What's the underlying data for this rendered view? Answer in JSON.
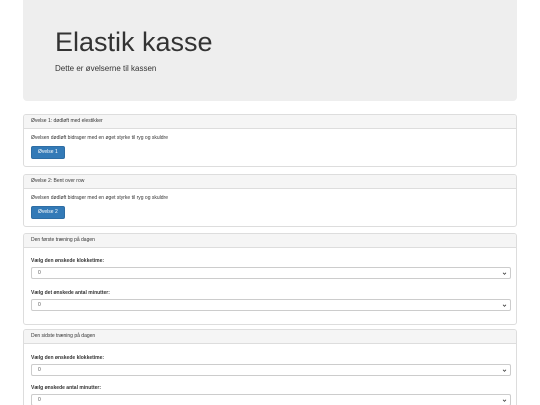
{
  "header": {
    "title": "Elastik kasse",
    "subtitle": "Dette er øvelserne til kassen"
  },
  "exercises": [
    {
      "heading": "Øvelse 1: dødløft med elestikker",
      "description": "Øvelsen dødløft bidrager med en øget styrke til ryg og skuldre",
      "button_label": "Øvelse 1"
    },
    {
      "heading": "Øvelse 2: Bent over row",
      "description": "Øvelsen dødløft bidrager med en øget styrke til ryg og skuldre",
      "button_label": "Øvelse 2"
    }
  ],
  "first_training": {
    "heading": "Den første træning på dagen",
    "hour_label": "Vælg den ønskede klokketime:",
    "hour_value": "0",
    "minutes_label": "Vælg det ønskede antal minutter:",
    "minutes_value": "0"
  },
  "last_training": {
    "heading": "Den sidste træning på dagen",
    "hour_label": "Vælg den ønskede klokketime:",
    "hour_value": "0",
    "minutes_label": "Vælg ønskede antal minutter:",
    "minutes_value": "0"
  },
  "colors": {
    "primary": "#337ab7",
    "jumbotron_bg": "#eeeeee",
    "panel_heading_bg": "#f5f5f5",
    "border": "#dddddd"
  }
}
